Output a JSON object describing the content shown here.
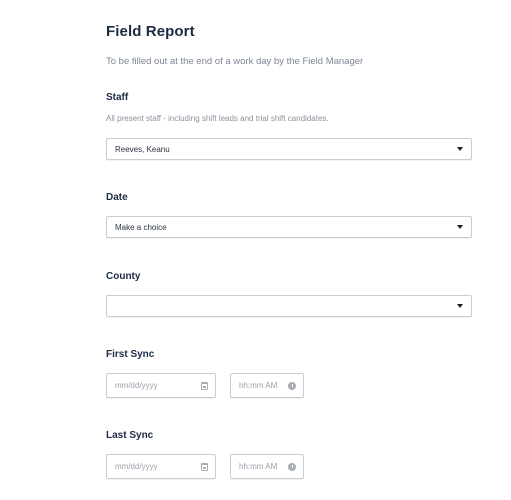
{
  "form": {
    "title": "Field Report",
    "subtitle": "To be filled out at the end of a work day by the Field Manager"
  },
  "fields": {
    "staff": {
      "label": "Staff",
      "help": "All present staff - including shift leads and trial shift candidates.",
      "value": "Reeves, Keanu"
    },
    "date": {
      "label": "Date",
      "value": "Make a choice"
    },
    "county": {
      "label": "County",
      "value": ""
    },
    "first_sync": {
      "label": "First Sync",
      "date_placeholder": "mm/dd/yyyy",
      "time_placeholder": "hh:mm AM"
    },
    "last_sync": {
      "label": "Last Sync",
      "date_placeholder": "mm/dd/yyyy",
      "time_placeholder": "hh:mm AM"
    }
  },
  "icons": {
    "select_caret": "caret-down-icon",
    "date": "calendar-icon",
    "time": "clock-icon"
  },
  "colors": {
    "heading": "#1b2a44",
    "muted_text": "#7c8594",
    "border": "#c9ccd1"
  }
}
